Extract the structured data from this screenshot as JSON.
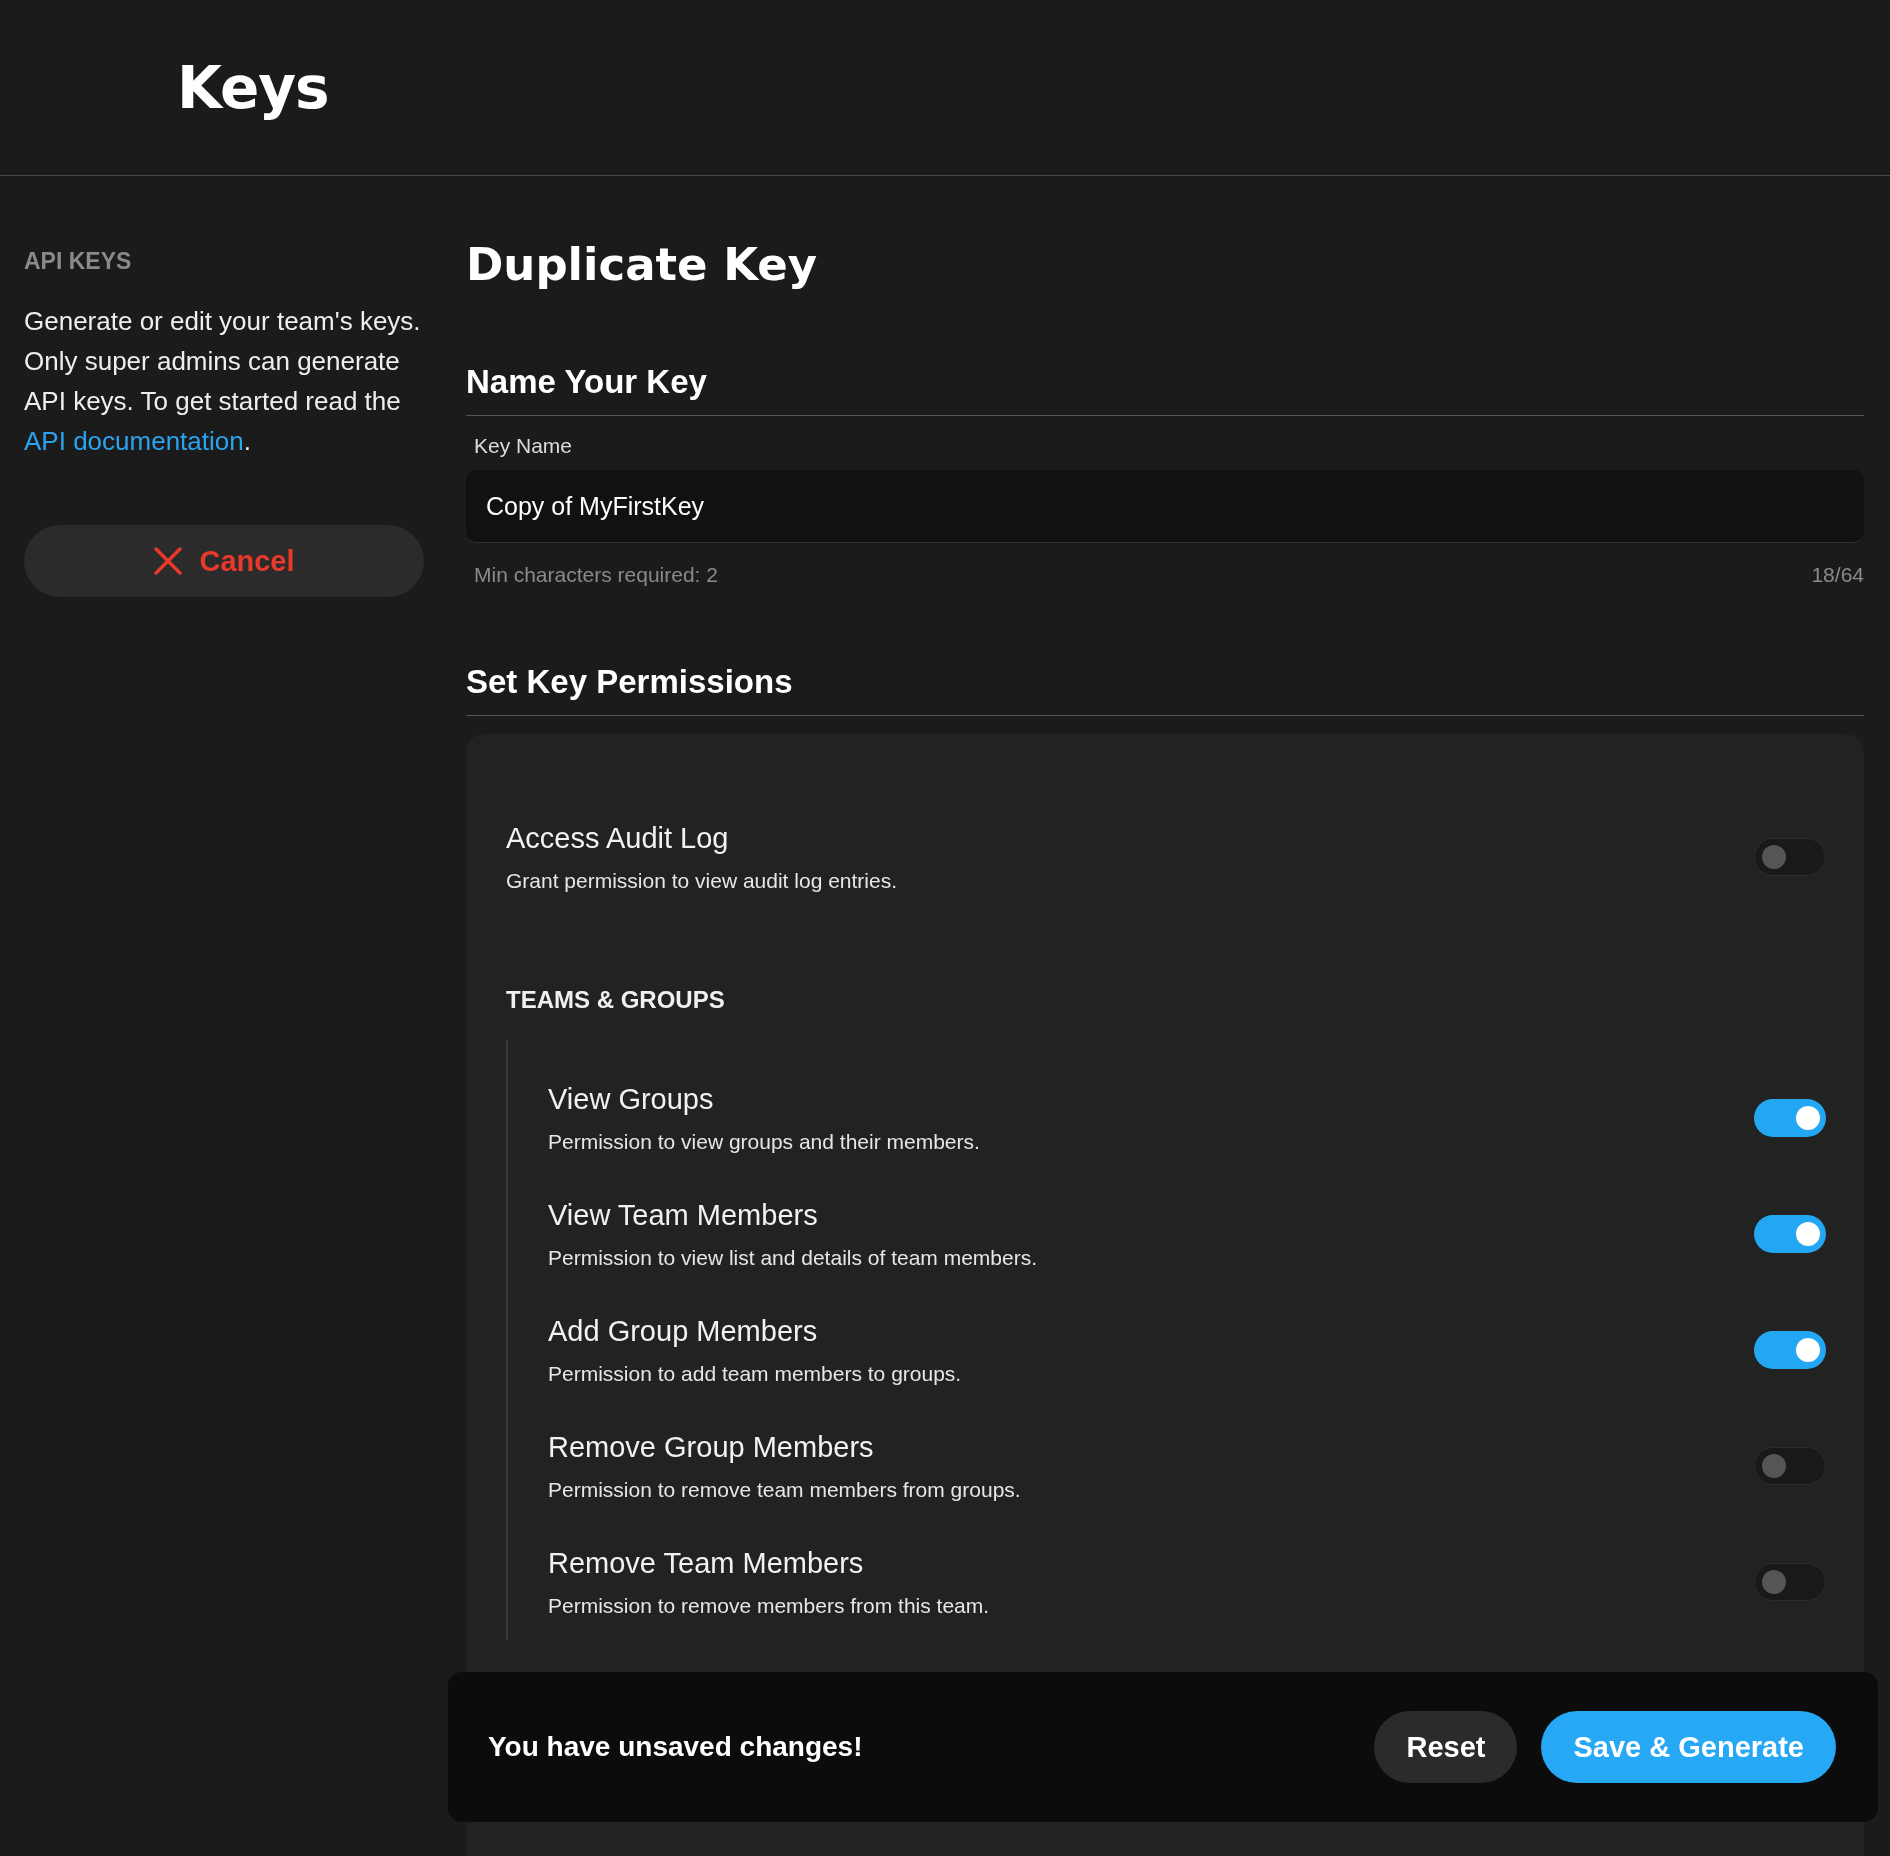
{
  "header": {
    "title": "Keys"
  },
  "sidebar": {
    "section_label": "API KEYS",
    "description": "Generate or edit your team's keys. Only super admins can generate API keys. To get started read the",
    "link": "API documentation",
    "link_suffix": ".",
    "cancel_button": "Cancel"
  },
  "main": {
    "title": "Duplicate Key",
    "name_section": {
      "heading": "Name Your Key",
      "field_label": "Key Name",
      "value": "Copy of MyFirstKey",
      "helper": "Min characters required: 2",
      "counter": "18/64"
    },
    "permissions_section": {
      "heading": "Set Key Permissions",
      "top_items": [
        {
          "title": "Access Audit Log",
          "description": "Grant permission to view audit log entries.",
          "on": false
        }
      ],
      "groups": [
        {
          "label": "TEAMS & GROUPS",
          "items": [
            {
              "title": "View Groups",
              "description": "Permission to view groups and their members.",
              "on": true
            },
            {
              "title": "View Team Members",
              "description": "Permission to view list and details of team members.",
              "on": true
            },
            {
              "title": "Add Group Members",
              "description": "Permission to add team members to groups.",
              "on": true
            },
            {
              "title": "Remove Group Members",
              "description": "Permission to remove team members from groups.",
              "on": false
            },
            {
              "title": "Remove Team Members",
              "description": "Permission to remove members from this team.",
              "on": false
            }
          ]
        }
      ]
    }
  },
  "unsaved_bar": {
    "message": "You have unsaved changes!",
    "reset_button": "Reset",
    "save_button": "Save & Generate"
  }
}
